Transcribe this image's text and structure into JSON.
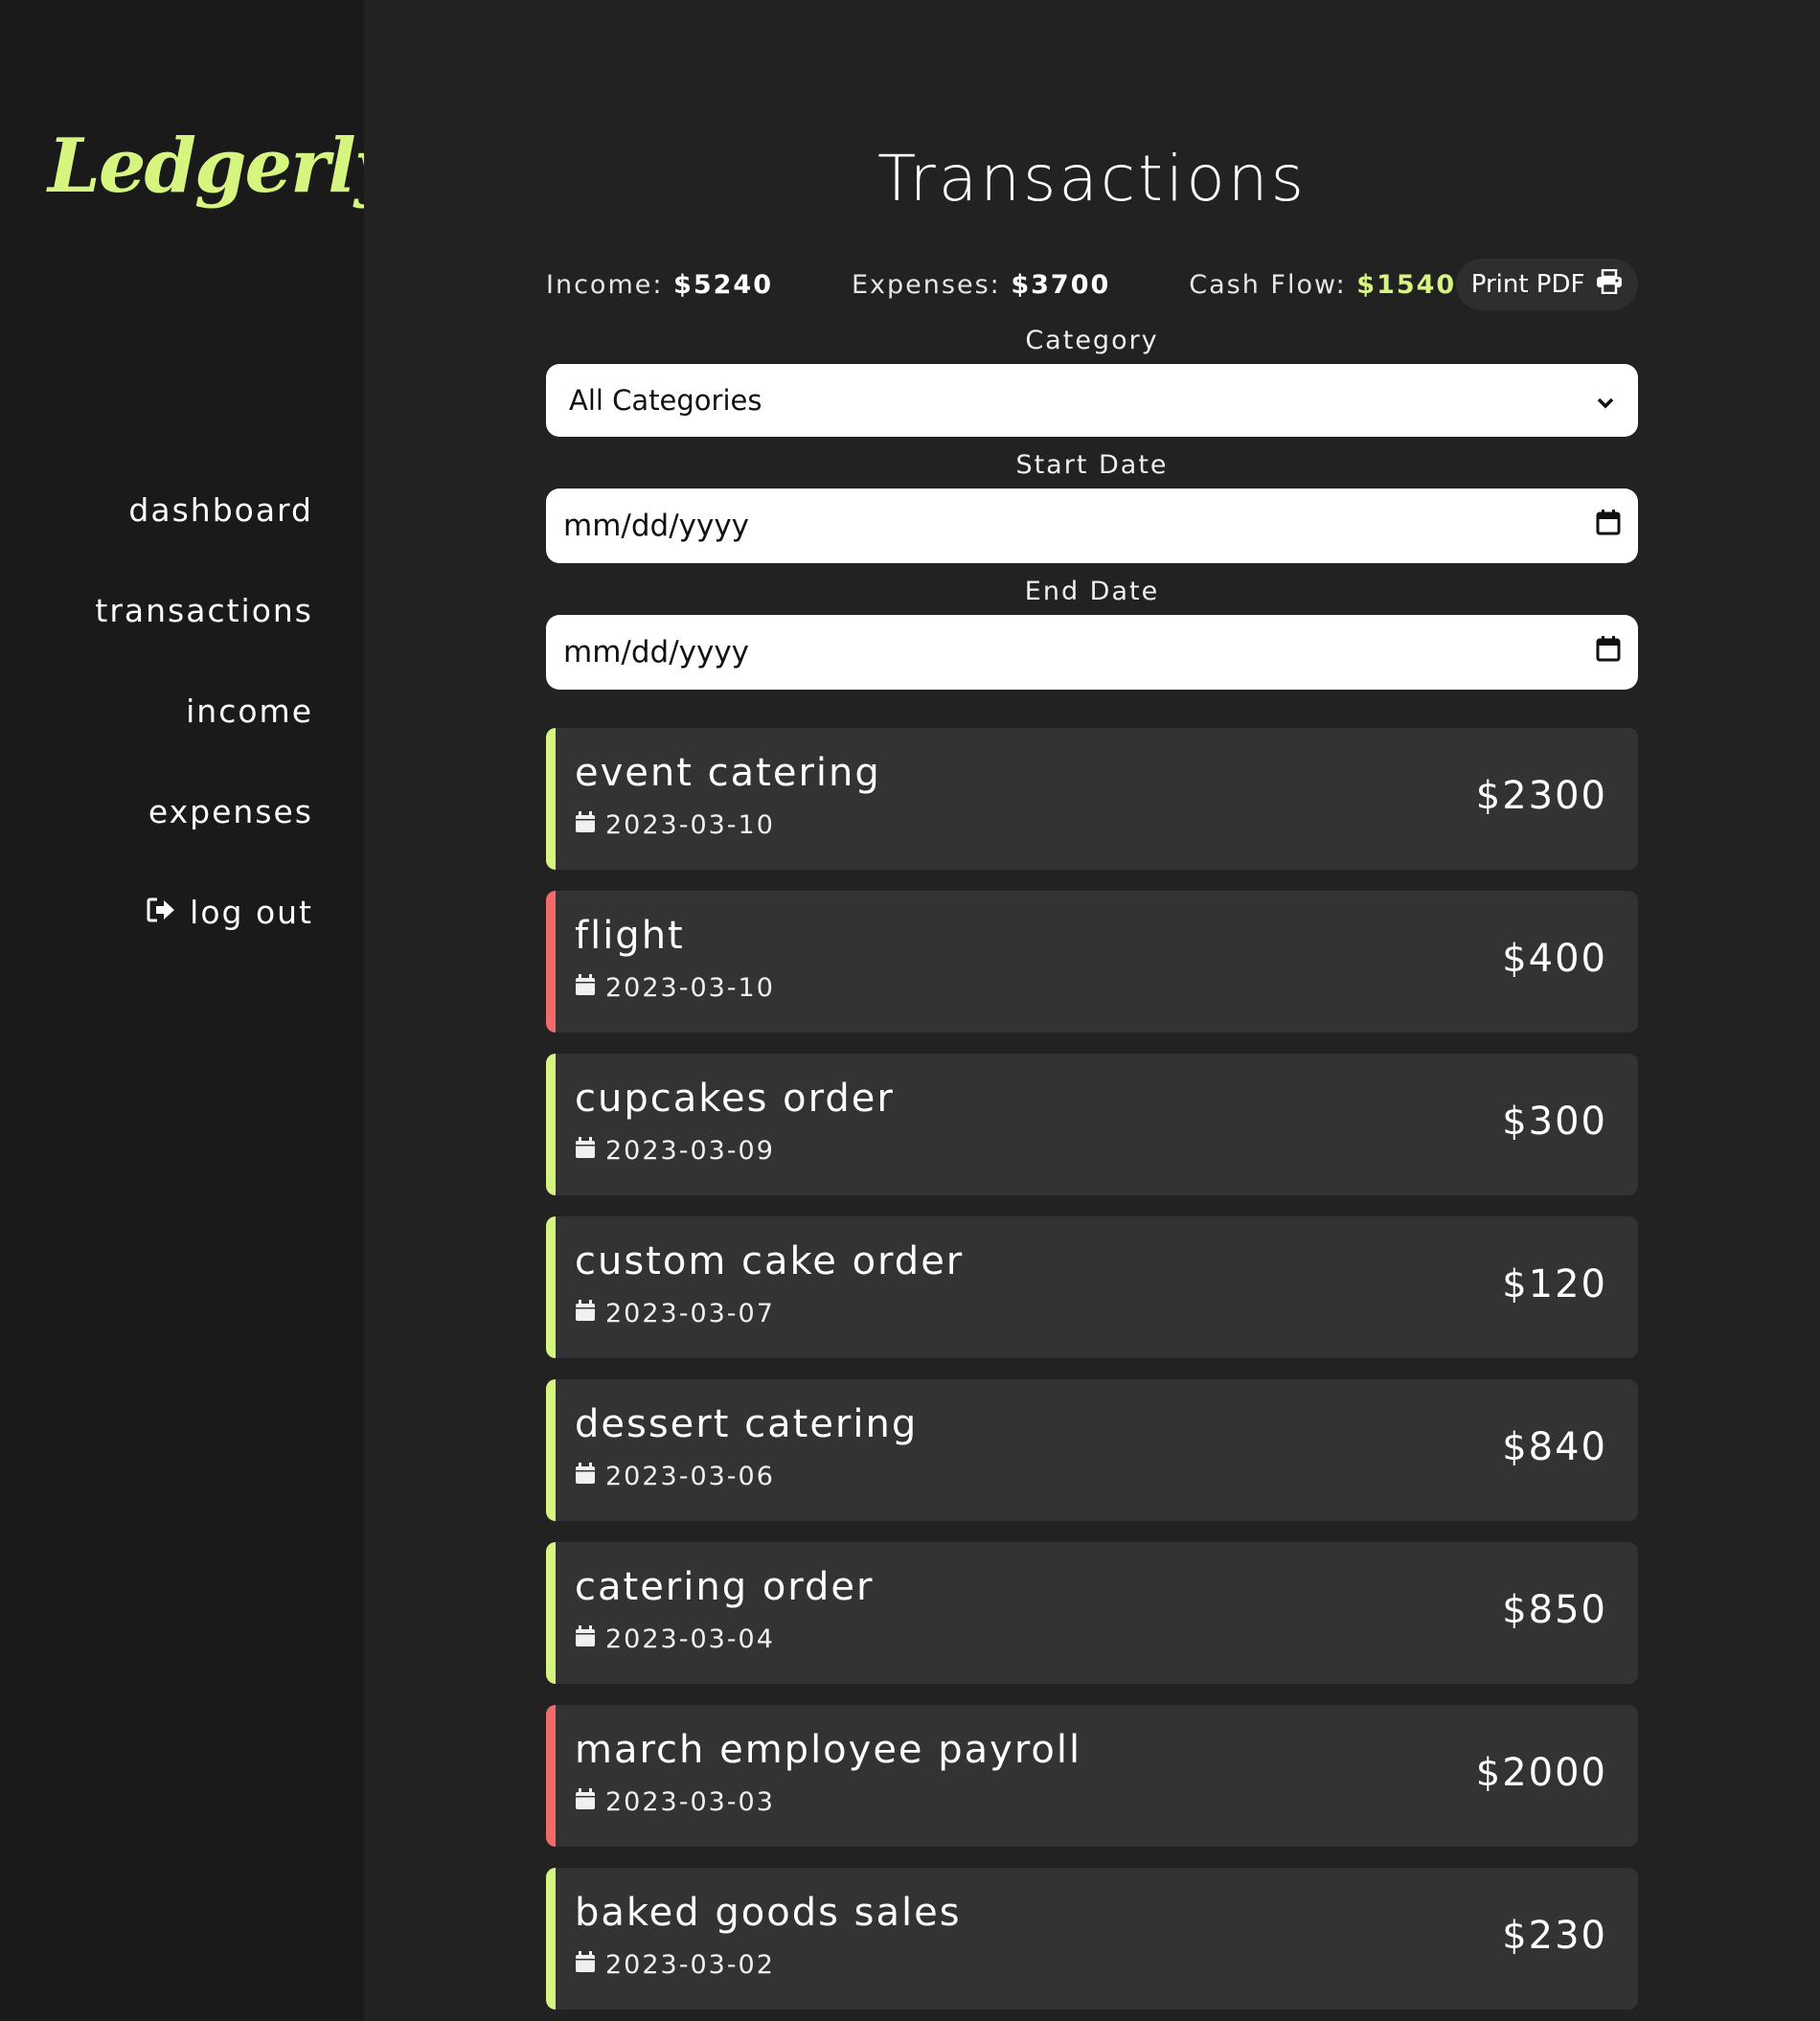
{
  "brand": {
    "logo_text": "Ledgerly"
  },
  "nav": {
    "items": [
      {
        "label": "dashboard"
      },
      {
        "label": "transactions"
      },
      {
        "label": "income"
      },
      {
        "label": "expenses"
      },
      {
        "label": "log out",
        "icon": "logout-icon"
      }
    ]
  },
  "page": {
    "title": "Transactions"
  },
  "summary": {
    "income_label": "Income:",
    "income_value": "$5240",
    "expenses_label": "Expenses:",
    "expenses_value": "$3700",
    "cashflow_label": "Cash Flow:",
    "cashflow_value": "$1540",
    "print_label": "Print PDF",
    "print_icon": "printer-icon"
  },
  "filters": {
    "category_label": "Category",
    "category_selected": "All Categories",
    "start_label": "Start Date",
    "start_placeholder": "mm/dd/yyyy",
    "end_label": "End Date",
    "end_placeholder": "mm/dd/yyyy"
  },
  "colors": {
    "accent": "#d6f57e",
    "income": "#d6f57e",
    "expense": "#f26b6b"
  },
  "transactions": [
    {
      "name": "event catering",
      "date": "2023-03-10",
      "amount": "$2300",
      "type": "income"
    },
    {
      "name": "flight",
      "date": "2023-03-10",
      "amount": "$400",
      "type": "expense"
    },
    {
      "name": "cupcakes order",
      "date": "2023-03-09",
      "amount": "$300",
      "type": "income"
    },
    {
      "name": "custom cake order",
      "date": "2023-03-07",
      "amount": "$120",
      "type": "income"
    },
    {
      "name": "dessert catering",
      "date": "2023-03-06",
      "amount": "$840",
      "type": "income"
    },
    {
      "name": "catering order",
      "date": "2023-03-04",
      "amount": "$850",
      "type": "income"
    },
    {
      "name": "march employee payroll",
      "date": "2023-03-03",
      "amount": "$2000",
      "type": "expense"
    },
    {
      "name": "baked goods sales",
      "date": "2023-03-02",
      "amount": "$230",
      "type": "income"
    }
  ]
}
